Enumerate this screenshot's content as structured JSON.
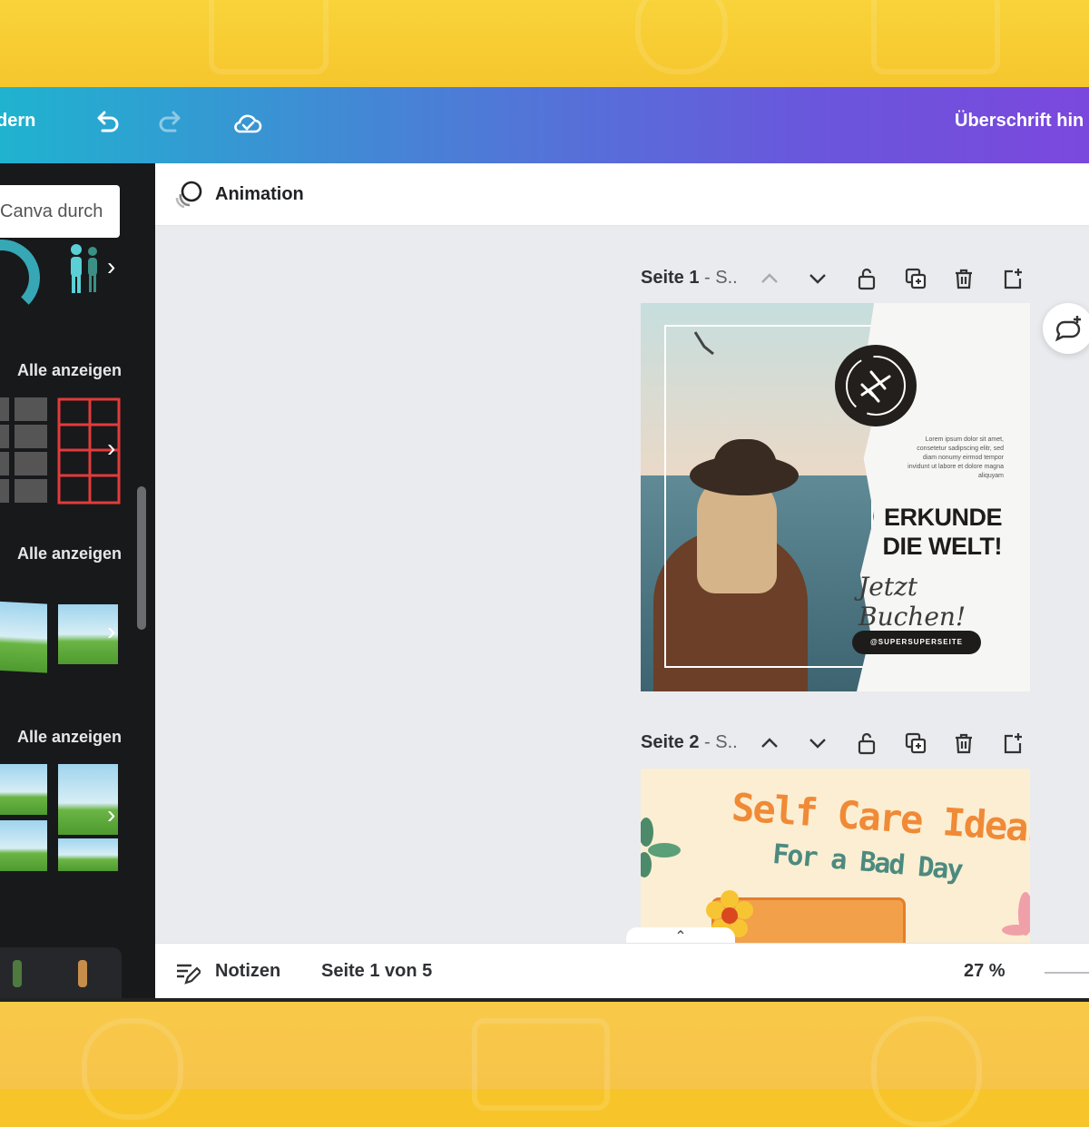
{
  "topbar": {
    "menu_label": "dern",
    "title": "Überschrift hin",
    "icons": [
      "undo-icon",
      "redo-icon",
      "cloud-saved-icon"
    ]
  },
  "sidebar": {
    "search_placeholder": "Canva durch",
    "sections": [
      {
        "link": "Alle anzeigen"
      },
      {
        "link": "Alle anzeigen"
      },
      {
        "link": "Alle anzeigen"
      }
    ]
  },
  "panel": {
    "animation_label": "Animation"
  },
  "pages": [
    {
      "label": "Seite 1",
      "suffix": " - S..",
      "design": {
        "headline_line1": "ERKUNDE",
        "headline_line2": "DIE WELT!",
        "script": "Jetzt Buchen!",
        "handle": "@SUPERSUPERSEITE",
        "small_text": "Lorem ipsum dolor sit amet, consetetur sadipscing elitr, sed diam nonumy eirmod tempor invidunt ut labore et dolore magna aliquyam"
      }
    },
    {
      "label": "Seite 2",
      "suffix": " - S..",
      "design": {
        "title": "Self Care Ideas",
        "subtitle": "For a Bad Day"
      }
    }
  ],
  "statusbar": {
    "notes_label": "Notizen",
    "page_indicator": "Seite 1 von 5",
    "zoom": "27 %"
  },
  "colors": {
    "topbar_start": "#1fb3cf",
    "topbar_end": "#7b48dd",
    "sidebar_bg": "#18191b",
    "canvas_bg": "#eaebee"
  }
}
